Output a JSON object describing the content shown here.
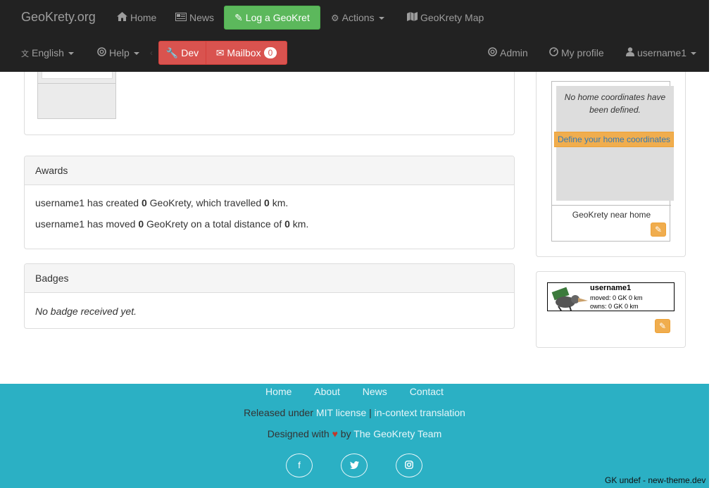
{
  "navbar": {
    "brand": "GeoKrety.org",
    "home": "Home",
    "news": "News",
    "log_button": "Log a GeoKret",
    "actions": "Actions",
    "map": "GeoKrety Map",
    "language": "English",
    "help": "Help",
    "dev_button": "Dev",
    "mailbox_button": "Mailbox",
    "mailbox_count": "0",
    "admin": "Admin",
    "profile": "My profile",
    "user": "username1",
    "bg_color": "#222222"
  },
  "awards": {
    "title": "Awards",
    "line1": {
      "pre": "username1 has created ",
      "count": "0",
      "mid": " GeoKrety, which travelled ",
      "km": "0",
      "post": " km."
    },
    "line2": {
      "pre": "username1 has moved ",
      "count": "0",
      "mid": " GeoKrety on a total distance of ",
      "km": "0",
      "post": " km."
    }
  },
  "badges": {
    "title": "Badges",
    "empty_text": "No badge received yet."
  },
  "home": {
    "no_coords": "No home coordinates have been defined.",
    "define_button": "Define your home coordinates",
    "caption": "GeoKrety near home"
  },
  "banner": {
    "username": "username1",
    "moved": "moved: 0 GK 0 km",
    "owns": "owns: 0 GK 0 km"
  },
  "footer": {
    "links": [
      "Home",
      "About",
      "News",
      "Contact"
    ],
    "released_pre": "Released under ",
    "license": "MIT license",
    "pipe": " | ",
    "translation": "in-context translation",
    "designed_pre": "Designed with ",
    "designed_by": " by ",
    "team": "The GeoKrety Team",
    "version": "GK undef - new-theme.dev",
    "bg_color": "#2bb0c4"
  }
}
